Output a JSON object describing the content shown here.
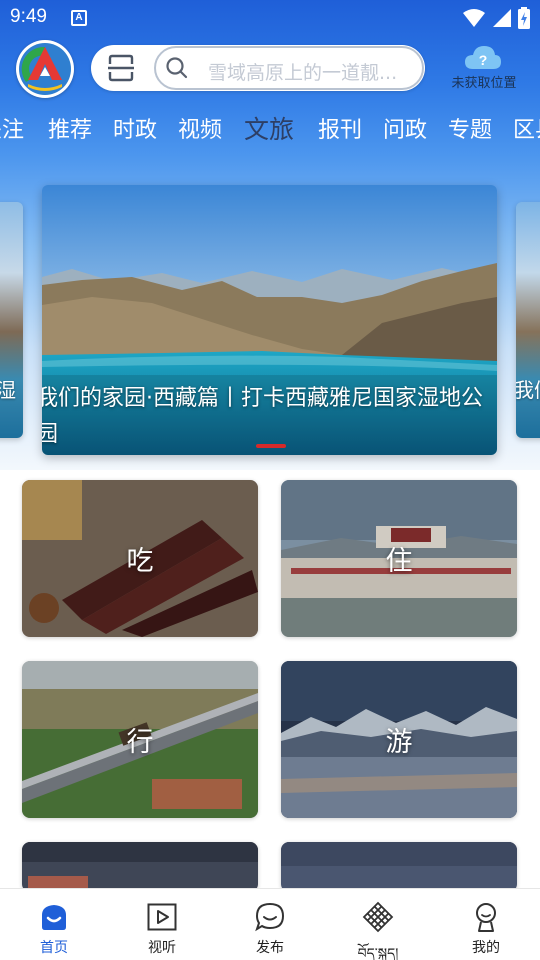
{
  "status_bar": {
    "time": "9:49",
    "notification_glyph": "A"
  },
  "header": {
    "search_placeholder": "雪域高原上的一道靓...",
    "location_label": "未获取位置"
  },
  "tabs": [
    {
      "label": "关注"
    },
    {
      "label": "推荐"
    },
    {
      "label": "时政"
    },
    {
      "label": "视频"
    },
    {
      "label": "文旅",
      "active": true
    },
    {
      "label": "报刊"
    },
    {
      "label": "问政"
    },
    {
      "label": "专题"
    },
    {
      "label": "区县"
    }
  ],
  "banner": {
    "caption": "我们的家园·西藏篇丨打卡西藏雅尼国家湿地公园",
    "left_peek_caption": "湿",
    "right_peek_caption": "我们"
  },
  "categories": [
    {
      "label": "吃"
    },
    {
      "label": "住"
    },
    {
      "label": "行"
    },
    {
      "label": "游"
    }
  ],
  "bottom_nav": [
    {
      "label": "首页",
      "icon": "home-icon",
      "active": true
    },
    {
      "label": "视听",
      "icon": "play-icon"
    },
    {
      "label": "发布",
      "icon": "chat-icon"
    },
    {
      "label": "བོད་སྐད།",
      "icon": "endless-knot-icon"
    },
    {
      "label": "我的",
      "icon": "profile-icon"
    }
  ],
  "colors": {
    "brand_blue": "#1f5fd8",
    "active_tab": "#2d3f66",
    "banner_indicator": "#d62a2a"
  }
}
